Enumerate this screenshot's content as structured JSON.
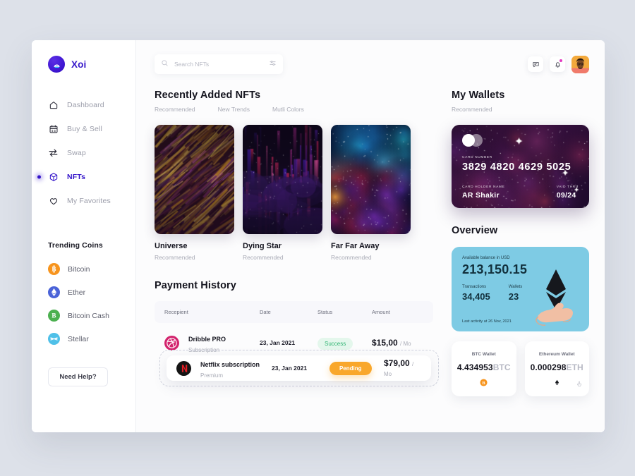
{
  "sidebar": {
    "brand": {
      "name": "Xoi",
      "logo_icon": "xoi-logo-icon",
      "color": "#3314c9"
    },
    "items": [
      {
        "label": "Dashboard",
        "icon": "home-icon",
        "active": false
      },
      {
        "label": "Buy & Sell",
        "icon": "calendar-icon",
        "active": false
      },
      {
        "label": "Swap",
        "icon": "swap-arrows-icon",
        "active": false
      },
      {
        "label": "NFTs",
        "icon": "cube-icon",
        "active": true
      },
      {
        "label": "My Favorites",
        "icon": "heart-icon",
        "active": false
      }
    ],
    "trending_title": "Trending Coins",
    "coins": [
      {
        "label": "Bitcoin",
        "symbol": "B",
        "color": "#f7941d",
        "icon": "bitcoin-icon"
      },
      {
        "label": "Ether",
        "symbol": "E",
        "color": "#4a63d8",
        "icon": "ethereum-icon"
      },
      {
        "label": "Bitcoin Cash",
        "symbol": "B",
        "color": "#4cb050",
        "icon": "bitcoin-cash-icon"
      },
      {
        "label": "Stellar",
        "symbol": "S",
        "color": "#4fc0e8",
        "icon": "stellar-icon"
      }
    ],
    "help_label": "Need Help?"
  },
  "topbar": {
    "search": {
      "placeholder": "Search NFTs",
      "value": "",
      "icon": "search-icon",
      "filter_icon": "filter-sliders-icon"
    },
    "actions": [
      {
        "name": "messages-icon"
      },
      {
        "name": "notifications-bell-icon",
        "badge": true
      }
    ],
    "avatar": "user-avatar"
  },
  "nfts": {
    "title": "Recently Added NFTs",
    "tabs": [
      "Recommended",
      "New Trends",
      "Mutli Colors"
    ],
    "cards": [
      {
        "name": "Universe",
        "tag": "Recommended",
        "art": "abstract-gold-purple-streaks"
      },
      {
        "name": "Dying Star",
        "tag": "Recommended",
        "art": "pink-purple-glitch-columns"
      },
      {
        "name": "Far Far Away",
        "tag": "Recommended",
        "art": "red-blue-nebula"
      }
    ]
  },
  "payments": {
    "title": "Payment History",
    "columns": [
      "Recepient",
      "Date",
      "Status",
      "Amount"
    ],
    "rows": [
      {
        "name": "Dribble PRO",
        "plan": "Subscription",
        "date": "23, Jan 2021",
        "status": "Success",
        "status_kind": "success",
        "amount": "$15,00",
        "period": "/ Mo",
        "avatar_icon": "dribbble-icon",
        "avatar_color": "#d3246d",
        "selected": false
      },
      {
        "name": "Netflix subscription",
        "plan": "Premium",
        "date": "23, Jan 2021",
        "status": "Pending",
        "status_kind": "pending",
        "amount": "$79,00",
        "period": "/ Mo",
        "avatar_icon": "netflix-icon",
        "avatar_color": "#1a1a1a",
        "selected": true
      }
    ]
  },
  "wallets": {
    "title": "My Wallets",
    "subtitle": "Recommended",
    "card": {
      "number_label": "CARD NUMBER",
      "number": "3829 4820 4629 5025",
      "holder_label": "CARD HOLDER NAME",
      "holder": "AR Shakir",
      "valid_label": "VAID THRU",
      "valid": "09/24",
      "art": "purple-galaxy"
    }
  },
  "overview": {
    "title": "Overview",
    "balance_label": "Available balance in USD",
    "balance": "213,150.15",
    "transactions_label": "Transactions",
    "transactions": "34,405",
    "wallets_label": "Wallets",
    "wallets": "23",
    "footer": "Last activity at 26 Nov, 2021",
    "bg_color": "#7ecbe4",
    "art_icon": "hand-holding-ethereum-icon"
  },
  "mini_wallets": [
    {
      "label": "BTC Wallet",
      "value": "4.434953",
      "unit": "BTC",
      "icon": "bitcoin-icon",
      "color": "#f7941d"
    },
    {
      "label": "Ethereum Wallet",
      "value": "0.000298",
      "unit": "ETH",
      "icon": "ethereum-icon",
      "color": "#1a1a1a"
    }
  ]
}
